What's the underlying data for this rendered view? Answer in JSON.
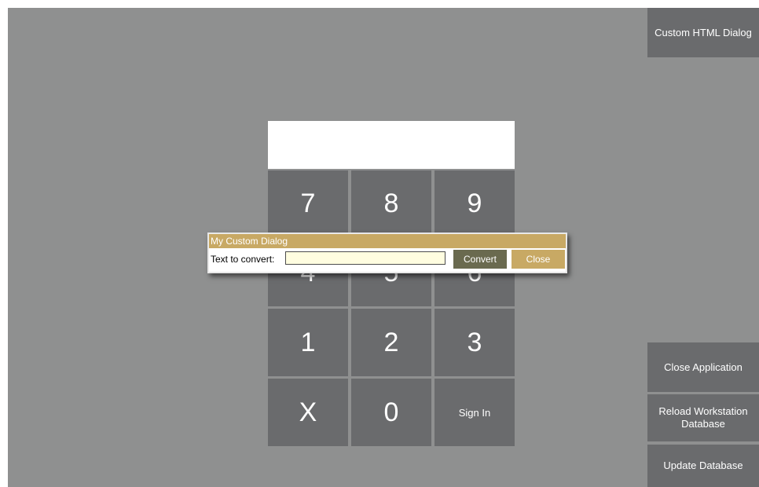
{
  "side_buttons": {
    "custom_html_dialog": "Custom HTML Dialog",
    "close_application": "Close Application",
    "reload_workstation_database": "Reload Workstation Database",
    "update_database": "Update Database"
  },
  "pin_display": {
    "value": ""
  },
  "keypad": {
    "keys": [
      "7",
      "8",
      "9",
      "4",
      "5",
      "6",
      "1",
      "2",
      "3",
      "X",
      "0",
      "Sign In"
    ]
  },
  "dialog": {
    "title": "My Custom Dialog",
    "label": "Text to convert:",
    "input_value": "",
    "convert_label": "Convert",
    "close_label": "Close"
  },
  "colors": {
    "background": "#8f9090",
    "button": "#6a6b6d",
    "dialog_accent": "#c8a964",
    "convert_button": "#6a6a4f",
    "input_background": "#fffde0"
  }
}
